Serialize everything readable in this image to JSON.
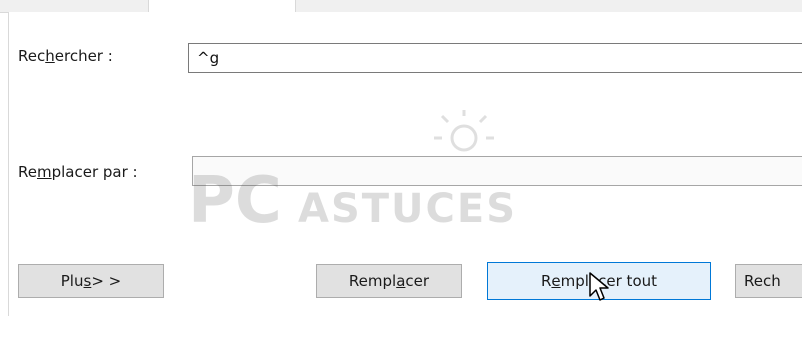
{
  "dialog": {
    "find": {
      "label_prefix": "Rec",
      "label_accel": "h",
      "label_suffix": "ercher :",
      "value": "^g"
    },
    "replace": {
      "label_prefix": "Re",
      "label_accel": "m",
      "label_suffix": "placer par :",
      "value": ""
    },
    "buttons": {
      "more": {
        "prefix": "Plu",
        "accel": "s",
        "suffix": " > >"
      },
      "replace": {
        "prefix": "Rempl",
        "accel": "a",
        "suffix": "cer"
      },
      "replace_all": {
        "prefix": "R",
        "accel": "e",
        "suffix": "mplacer tout"
      },
      "find_next": "Rech"
    }
  },
  "watermark": {
    "text_bold": "PC",
    "text_rest": "ASTUCES"
  },
  "icons": {
    "pointer": "arrow-cursor-icon"
  },
  "colors": {
    "focus_border": "#0078d7",
    "focus_fill": "#e5f1fb",
    "button_fill": "#e1e1e1"
  }
}
